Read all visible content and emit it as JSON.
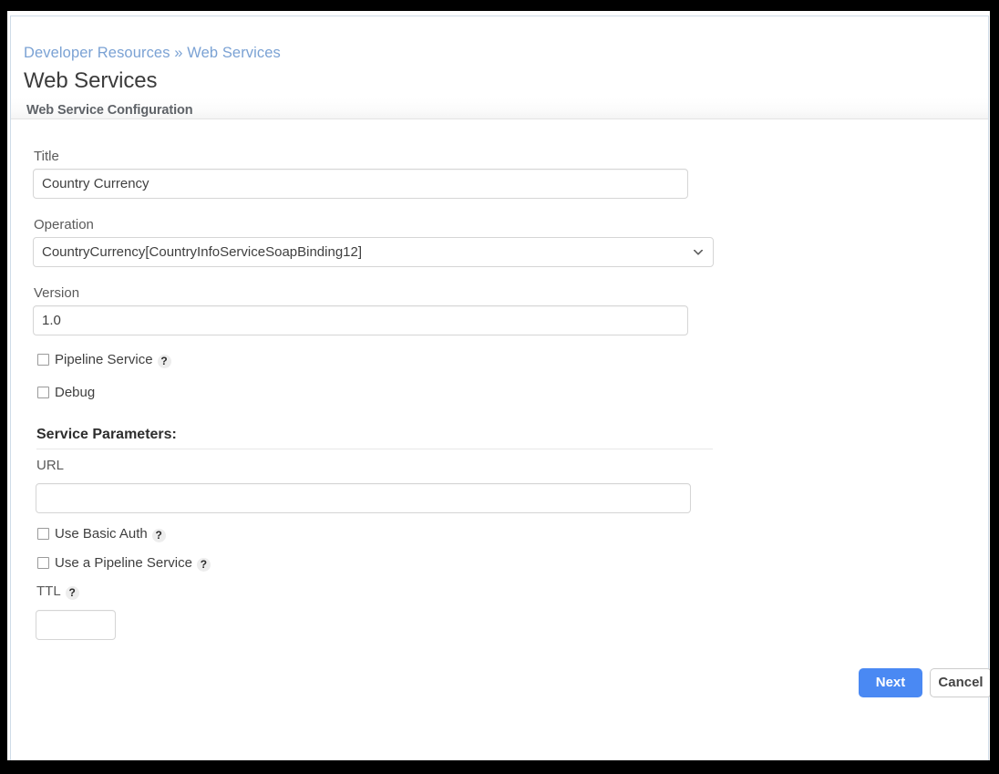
{
  "header": {
    "breadcrumb_parent": "Developer Resources",
    "breadcrumb_separator": "»",
    "breadcrumb_current": "Web Services",
    "title": "Web Services",
    "subtitle": "Web Service Configuration"
  },
  "form": {
    "title_label": "Title",
    "title_value": "Country Currency",
    "title_placeholder": "",
    "operation_label": "Operation",
    "operation_value": "CountryCurrency[CountryInfoServiceSoapBinding12]",
    "version_label": "Version",
    "version_value": "1.0",
    "version_placeholder": "",
    "pipeline_service_label": "Pipeline Service",
    "pipeline_service_checked": false,
    "debug_label": "Debug",
    "debug_checked": false
  },
  "service_parameters": {
    "heading": "Service Parameters:",
    "url_label": "URL",
    "url_value": "",
    "url_placeholder": "",
    "use_basic_auth_label": "Use Basic Auth",
    "use_basic_auth_checked": false,
    "use_pipeline_service_label": "Use a Pipeline Service",
    "use_pipeline_service_checked": false,
    "ttl_label": "TTL",
    "ttl_value": "",
    "ttl_placeholder": ""
  },
  "actions": {
    "next_label": "Next",
    "cancel_label": "Cancel"
  },
  "icons": {
    "help": "?",
    "chevron_down": "chevron-down-icon"
  },
  "colors": {
    "link": "#7ba2d4",
    "primary_button": "#4a89f3",
    "panel_border": "#cfdce8",
    "frame": "#000000"
  }
}
